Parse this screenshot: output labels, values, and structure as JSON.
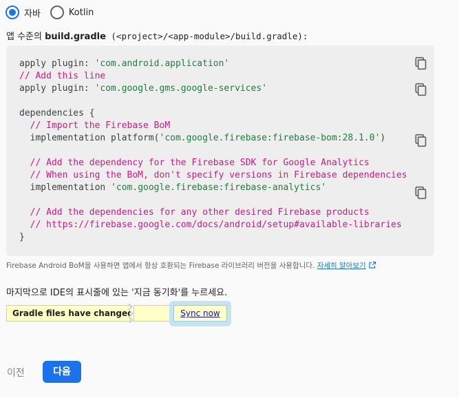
{
  "language_options": [
    {
      "label": "자바",
      "selected": true
    },
    {
      "label": "Kotlin",
      "selected": false
    }
  ],
  "file_desc": {
    "prefix": "앱 수준의 ",
    "filename": "build.gradle",
    "path": " (<project>/<app-module>/build.gradle):"
  },
  "code": {
    "l1_kw": "apply plugin: ",
    "l1_str": "'com.android.application'",
    "l2_cmt": "// Add this line",
    "l3_kw": "apply plugin: ",
    "l3_str": "'com.google.gms.google-services'",
    "l4": "dependencies {",
    "l5_cmt": "  // Import the Firebase BoM",
    "l6_kw": "  implementation platform(",
    "l6_str": "'com.google.firebase:firebase-bom:28.1.0'",
    "l6_end": ")",
    "l7_cmt": "  // Add the dependency for the Firebase SDK for Google Analytics",
    "l8_cmt": "  // When using the BoM, don't specify versions in Firebase dependencies",
    "l9_kw": "  implementation ",
    "l9_str": "'com.google.firebase:firebase-analytics'",
    "l10_cmt": "  // Add the dependencies for any other desired Firebase products",
    "l11_cmt": "  // https://firebase.google.com/docs/android/setup#available-libraries",
    "l12": "}"
  },
  "colors": {
    "accent": "#1a73e8",
    "comment": "#d01884",
    "string": "#188038",
    "code_bg": "#eeeeee"
  },
  "bom_note": {
    "text": "Firebase Android BoM을 사용하면 앱에서 항상 호환되는 Firebase 라이브러리 버전을 사용합니다. ",
    "link": "자세히 알아보기"
  },
  "sync_instruction": "마지막으로 IDE의 표시줄에 있는 '지금 동기화'를 누르세요.",
  "gradle_bar": {
    "message": "Gradle files have changed since last project sync",
    "sync_label": "Sync now"
  },
  "nav": {
    "prev_label": "이전",
    "next_label": "다음"
  }
}
